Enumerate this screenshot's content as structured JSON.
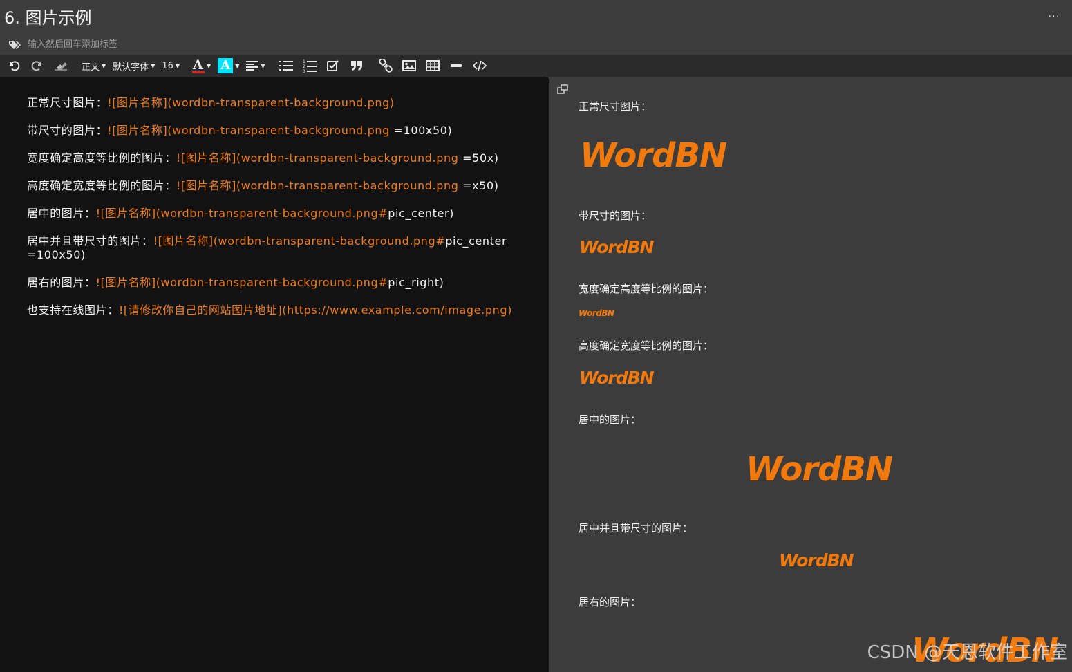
{
  "header": {
    "title": "6. 图片示例",
    "more": "...",
    "tag_placeholder": "输入然后回车添加标签"
  },
  "toolbar": {
    "paragraph": "正文",
    "font": "默认字体",
    "size": "16",
    "font_color_glyph": "A",
    "highlight_glyph": "A",
    "colors": {
      "font_underline": "#e02020",
      "highlight": "#00e5ff"
    }
  },
  "editor": {
    "lines": [
      {
        "plain": "正常尺寸图片：",
        "md": "![图片名称](wordbn-transparent-background.png)",
        "tail": ""
      },
      {
        "plain": "带尺寸的图片：",
        "md": "![图片名称](wordbn-transparent-background.png",
        "tail": " =100x50)"
      },
      {
        "plain": "宽度确定高度等比例的图片：",
        "md": "![图片名称](wordbn-transparent-background.png",
        "tail": " =50x)"
      },
      {
        "plain": "高度确定宽度等比例的图片：",
        "md": "![图片名称](wordbn-transparent-background.png",
        "tail": " =x50)"
      },
      {
        "plain": "居中的图片：",
        "md": "![图片名称](wordbn-transparent-background.png#",
        "tail": "pic_center)"
      },
      {
        "plain": "居中并且带尺寸的图片：",
        "md": "![图片名称](wordbn-transparent-background.png#",
        "tail": "pic_center =100x50)"
      },
      {
        "plain": "居右的图片：",
        "md": "![图片名称](wordbn-transparent-background.png#",
        "tail": "pic_right)"
      },
      {
        "plain": "也支持在线图片：",
        "md": "![请修改你自己的网站图片地址](https://www.example.com/image.png)",
        "tail": ""
      }
    ]
  },
  "preview": {
    "labels": [
      "正常尺寸图片：",
      "带尺寸的图片：",
      "宽度确定高度等比例的图片：",
      "高度确定宽度等比例的图片：",
      "居中的图片：",
      "居中并且带尺寸的图片：",
      "居右的图片："
    ],
    "logo_text": "WordBN",
    "logo_color": "#f27a0d"
  },
  "watermark": "CSDN @天恩软件工作室"
}
